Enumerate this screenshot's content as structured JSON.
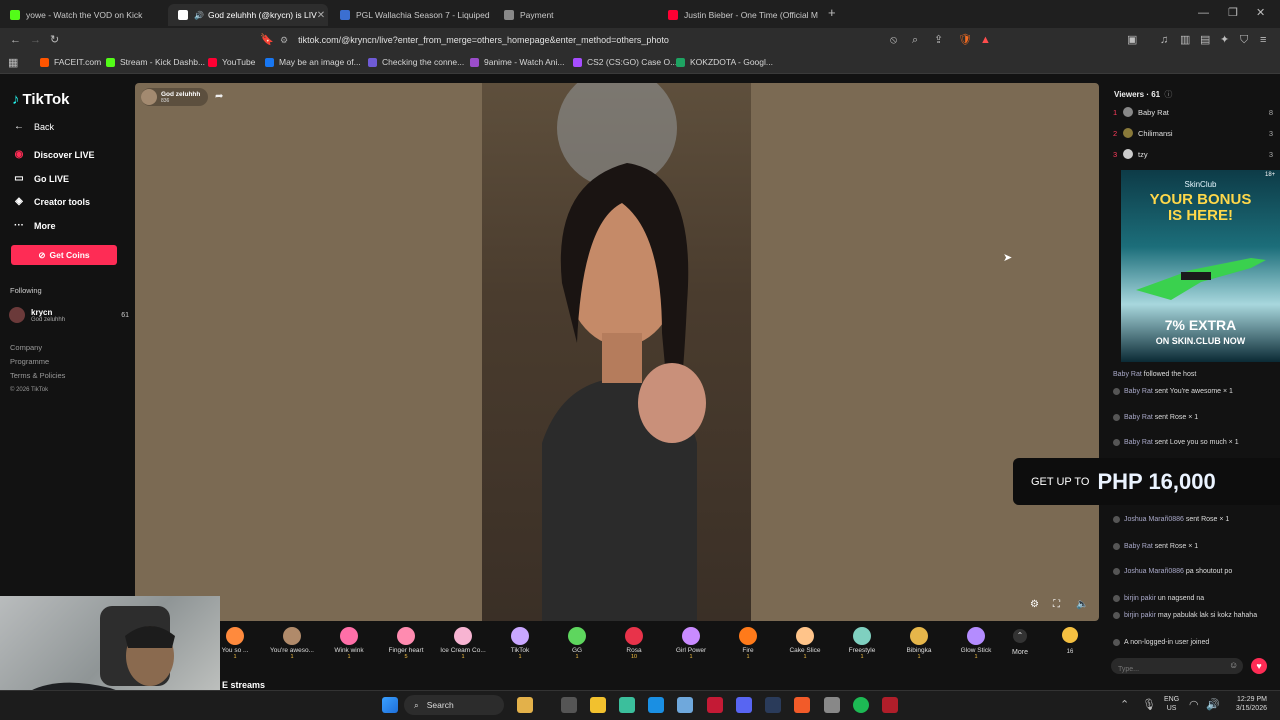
{
  "browser": {
    "tabs": [
      {
        "label": "yowe - Watch the VOD on Kick",
        "color": "#53fc18"
      },
      {
        "label": "God zeluhhh (@krycn) is LIV",
        "color": "#ffffff",
        "active": true
      },
      {
        "label": "PGL Wallachia Season 7 - Liquipedia",
        "color": "#3b6fd1"
      },
      {
        "label": "Payment",
        "color": "#888888"
      },
      {
        "label": "Justin Bieber - One Time (Official Mu",
        "color": "#ff0033"
      }
    ],
    "new_tab": "+",
    "url": "tiktok.com/@kryncn/live?enter_from_merge=others_homepage&enter_method=others_photo",
    "bookmarks": [
      {
        "label": "FACEIT.com",
        "color": "#ff5500"
      },
      {
        "label": "Stream - Kick Dashb...",
        "color": "#53fc18"
      },
      {
        "label": "YouTube",
        "color": "#ff0033"
      },
      {
        "label": "May be an image of...",
        "color": "#1877f2"
      },
      {
        "label": "Checking the conne...",
        "color": "#6f5bd6"
      },
      {
        "label": "9anime - Watch Ani...",
        "color": "#9b4dca"
      },
      {
        "label": "CS2 (CS:GO) Case O...",
        "color": "#a64dff"
      },
      {
        "label": "KOKZDOTA - Googl...",
        "color": "#1ea362"
      }
    ]
  },
  "sidebar": {
    "logo": "TikTok",
    "back": "Back",
    "nav": [
      "Discover LIVE",
      "Go LIVE",
      "Creator tools",
      "More"
    ],
    "get_coins": "Get Coins",
    "following_label": "Following",
    "following": {
      "name": "krycn",
      "sub": "God zeluhhh",
      "count": "61"
    },
    "footer": [
      "Company",
      "Programme",
      "Terms & Policies",
      "© 2026 TikTok"
    ]
  },
  "stream": {
    "host_name": "God zeluhhh",
    "host_sub": "836"
  },
  "gifts": [
    {
      "name": "You so ...",
      "price": "1",
      "color": "#ff8a3d"
    },
    {
      "name": "You're aweso...",
      "price": "1",
      "color": "#b08a6a"
    },
    {
      "name": "Wink wink",
      "price": "1",
      "color": "#ff6fa8"
    },
    {
      "name": "Finger heart",
      "price": "5",
      "color": "#ff8bb0"
    },
    {
      "name": "Ice Cream Co...",
      "price": "1",
      "color": "#f7b4d2"
    },
    {
      "name": "TikTok",
      "price": "1",
      "color": "#c9a7ff"
    },
    {
      "name": "GG",
      "price": "1",
      "color": "#5ed65e"
    },
    {
      "name": "Rosa",
      "price": "10",
      "color": "#e8334a"
    },
    {
      "name": "Girl Power",
      "price": "1",
      "color": "#c98bff"
    },
    {
      "name": "Fire",
      "price": "1",
      "color": "#ff7a1a"
    },
    {
      "name": "Cake Slice",
      "price": "1",
      "color": "#ffc48a"
    },
    {
      "name": "Freestyle",
      "price": "1",
      "color": "#7fd0c0"
    },
    {
      "name": "Bibingka",
      "price": "1",
      "color": "#e6b64a"
    },
    {
      "name": "Glow Stick",
      "price": "1",
      "color": "#b48cff"
    }
  ],
  "gift_more": "More",
  "coin_balance": "16",
  "below_gifts_text": "E streams",
  "viewers": {
    "title": "Viewers · 61",
    "top": [
      {
        "rank": "1",
        "name": "Baby Rat",
        "count": "8"
      },
      {
        "rank": "2",
        "name": "Chilimansi",
        "count": "3"
      },
      {
        "rank": "3",
        "name": "tzy",
        "count": "3"
      }
    ]
  },
  "ad": {
    "brand": "SkinClub",
    "headline_line1": "YOUR BONUS",
    "headline_line2": "IS HERE!",
    "offer": "7% EXTRA",
    "sub": "ON SKIN.CLUB NOW",
    "age": "18+"
  },
  "promo": {
    "lead": "GET UP TO",
    "amount": "PHP 16,000"
  },
  "chat": [
    {
      "name": "Baby Rat",
      "text": "followed the host"
    },
    {
      "name": "Baby Rat",
      "text": "sent You're awesome × 1"
    },
    {
      "name": "Baby Rat",
      "text": "sent Rose × 1"
    },
    {
      "name": "Baby Rat",
      "text": "sent Love you so much × 1"
    },
    {
      "name": "Joshua Marañ0886",
      "text": "sent Rose × 1"
    },
    {
      "name": "Baby Rat",
      "text": "sent Rose × 1"
    },
    {
      "name": "Joshua Marañ0886",
      "text": "pa shoutout po"
    },
    {
      "name": "birjin pakir",
      "text": "un nagsend na"
    },
    {
      "name": "birjin pakir",
      "text": "may pabulak lak si kokz hahaha"
    },
    {
      "name": "",
      "text": "A non-logged-in user joined"
    }
  ],
  "chat_input_placeholder": "Type...",
  "taskbar": {
    "search": "Search",
    "lang": "ENG",
    "region": "US",
    "time": "12:29 PM",
    "date": "3/15/2026"
  }
}
